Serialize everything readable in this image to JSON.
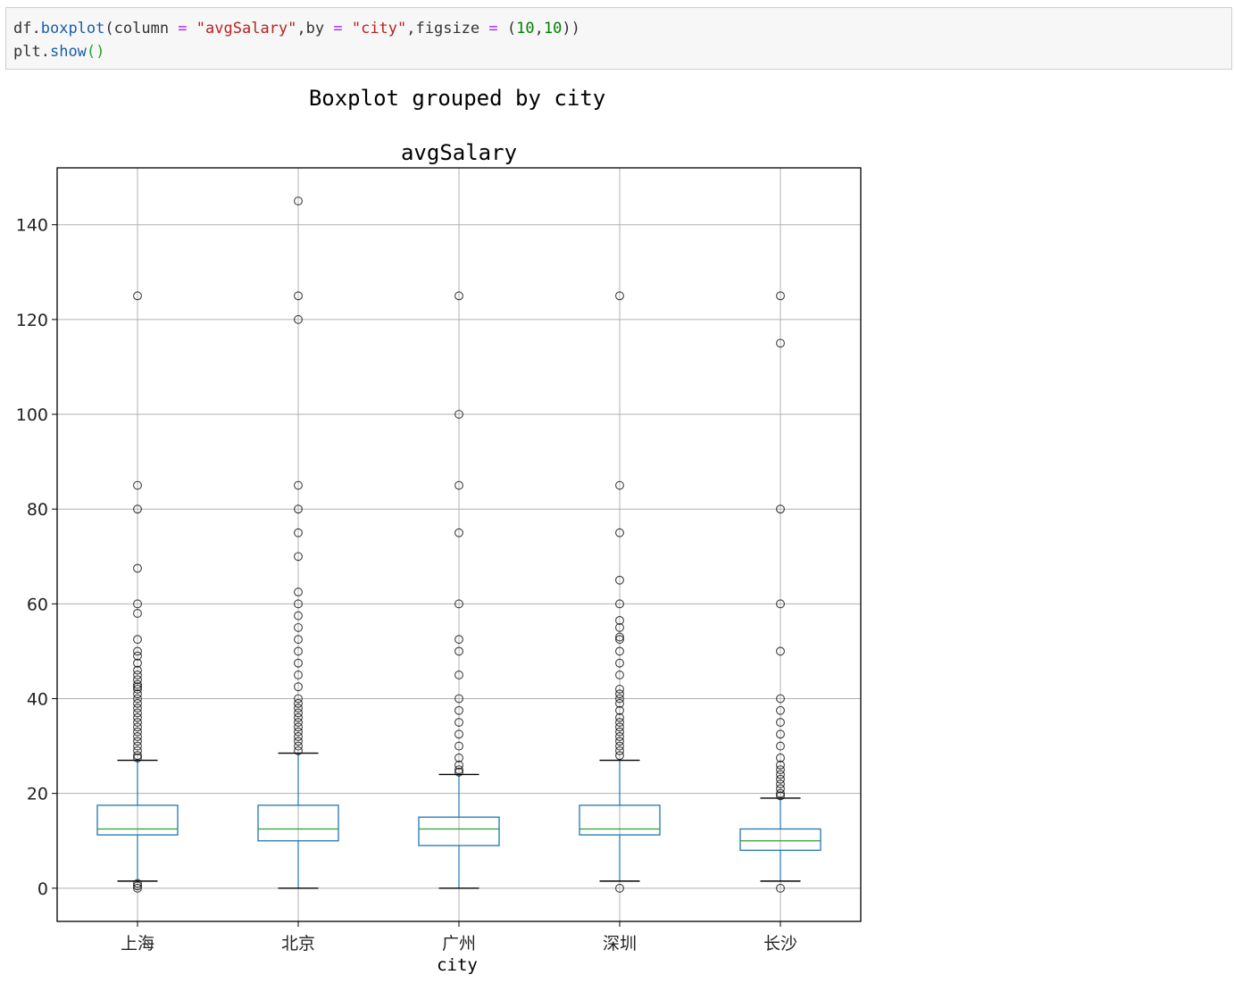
{
  "code": {
    "line1": {
      "obj": "df",
      "dot1": ".",
      "fn": "boxplot",
      "open": "(",
      "arg1": "column ",
      "eq1": "=",
      "sp1": " ",
      "val1": "\"avgSalary\"",
      "arg2": ",by ",
      "eq2": "=",
      "sp2": " ",
      "val2": "\"city\"",
      "arg3": ",figsize ",
      "eq3": "=",
      "sp3": " ",
      "tup_open": "(",
      "n1": "10",
      "comma": ",",
      "n2": "10",
      "close": "))"
    },
    "line2": {
      "obj": "plt",
      "dot": ".",
      "fn": "show",
      "parens": "()"
    }
  },
  "chart_data": {
    "type": "box",
    "suptitle": "Boxplot grouped by city",
    "title": "avgSalary",
    "xlabel": "city",
    "ylabel": "",
    "ylim": [
      -7,
      152
    ],
    "yticks": [
      0,
      20,
      40,
      60,
      80,
      100,
      120,
      140
    ],
    "grid": true,
    "colors": {
      "box": "#1f77b4",
      "median": "#2ca02c",
      "flier": "#000000",
      "grid": "#b0b0b0"
    },
    "categories": [
      "上海",
      "北京",
      "广州",
      "深圳",
      "长沙"
    ],
    "boxes": [
      {
        "whislo": 1.5,
        "q1": 11.25,
        "med": 12.5,
        "q3": 17.5,
        "whishi": 27,
        "fliers": [
          0,
          0.5,
          1,
          27.5,
          28,
          29,
          30,
          31,
          32,
          33,
          34,
          35,
          36,
          37,
          38,
          39,
          40,
          41,
          42,
          42.5,
          43,
          44,
          45,
          46,
          47.5,
          49,
          50,
          52.5,
          58,
          60,
          67.5,
          80,
          85,
          125
        ]
      },
      {
        "whislo": 0,
        "q1": 10,
        "med": 12.5,
        "q3": 17.5,
        "whishi": 28.5,
        "fliers": [
          29,
          30,
          31,
          32,
          33,
          34,
          35,
          36,
          37,
          38,
          39,
          40,
          42.5,
          45,
          47.5,
          50,
          52.5,
          55,
          57.5,
          60,
          62.5,
          70,
          75,
          80,
          85,
          120,
          125,
          145
        ]
      },
      {
        "whislo": 0,
        "q1": 9,
        "med": 12.5,
        "q3": 15,
        "whishi": 24,
        "fliers": [
          24.5,
          25,
          26,
          27.5,
          30,
          32.5,
          35,
          37.5,
          40,
          45,
          50,
          52.5,
          60,
          75,
          85,
          100,
          125
        ]
      },
      {
        "whislo": 1.5,
        "q1": 11.25,
        "med": 12.5,
        "q3": 17.5,
        "whishi": 27,
        "fliers": [
          0,
          28,
          29,
          30,
          31,
          32,
          33,
          34,
          35,
          36,
          37.5,
          39,
          40,
          41,
          42,
          45,
          47.5,
          50,
          52.5,
          53,
          55,
          56.5,
          60,
          65,
          75,
          85,
          125
        ]
      },
      {
        "whislo": 1.5,
        "q1": 8,
        "med": 10,
        "q3": 12.5,
        "whishi": 19,
        "fliers": [
          0,
          19.5,
          20,
          21,
          22,
          23,
          24,
          25,
          26,
          27.5,
          30,
          32.5,
          35,
          37.5,
          40,
          50,
          60,
          80,
          115,
          125
        ]
      }
    ]
  }
}
